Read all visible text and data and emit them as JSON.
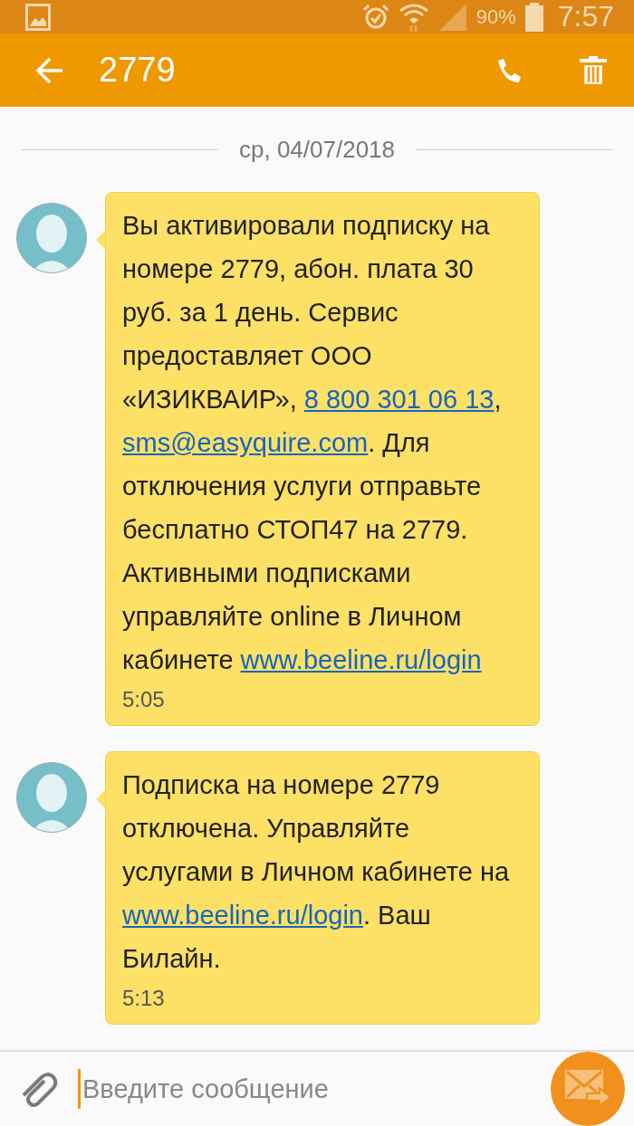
{
  "status_bar": {
    "battery": "90%",
    "time": "7:57"
  },
  "toolbar": {
    "title": "2779"
  },
  "date_divider": "ср, 04/07/2018",
  "messages": [
    {
      "parts": [
        {
          "kind": "text",
          "text": "Вы активировали подписку на номере 2779, абон. плата 30 руб. за 1 день. Сервис предоставляет ООО «ИЗИКВАИР», "
        },
        {
          "kind": "link",
          "text": "8 800 301 06 13"
        },
        {
          "kind": "text",
          "text": ", "
        },
        {
          "kind": "link",
          "text": "sms@easyquire.com"
        },
        {
          "kind": "text",
          "text": ". Для отключения услуги отправьте бесплатно СТОП47 на 2779. Активными подписками управляйте online в Личном кабинете "
        },
        {
          "kind": "link",
          "text": "www.beeline.ru/login"
        }
      ],
      "time": "5:05"
    },
    {
      "parts": [
        {
          "kind": "text",
          "text": "Подписка на номере 2779 отключена. Управляйте услугами в Личном кабинете на "
        },
        {
          "kind": "link",
          "text": "www.beeline.ru/login"
        },
        {
          "kind": "text",
          "text": ". Ваш Билайн."
        }
      ],
      "time": "5:13"
    }
  ],
  "composer": {
    "placeholder": "Введите сообщение"
  }
}
